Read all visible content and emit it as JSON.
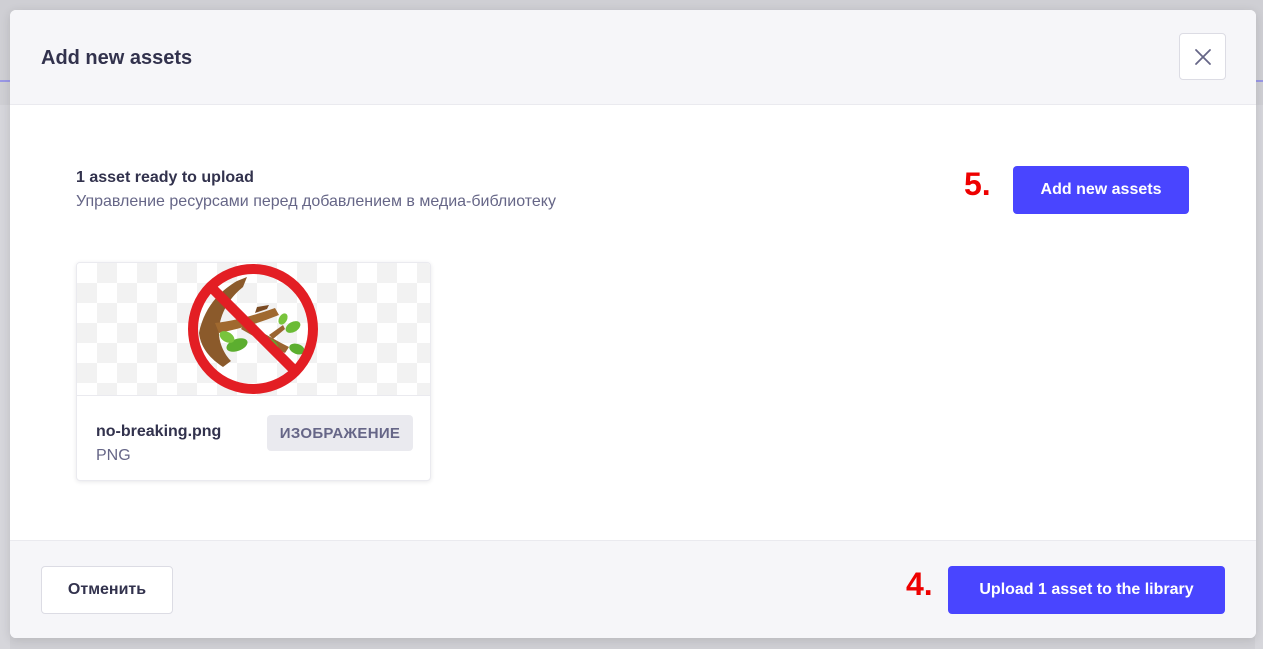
{
  "modal": {
    "title": "Add new assets",
    "close_icon": "close-icon"
  },
  "summary": {
    "title": "1 asset ready to upload",
    "subtitle": "Управление ресурсами перед добавлением в медиа-библиотеку"
  },
  "actions": {
    "add_label": "Add new assets",
    "add_step_marker": "5.",
    "upload_label": "Upload 1 asset to the library",
    "upload_step_marker": "4.",
    "cancel_label": "Отменить"
  },
  "asset": {
    "name": "no-breaking.png",
    "extension": "PNG",
    "type_badge": "ИЗОБРАЖЕНИЕ",
    "preview_icon": "no-breaking-branch-icon"
  },
  "colors": {
    "primary": "#4945ff",
    "annotation": "#ee0000",
    "prohibition": "#e31e24"
  }
}
